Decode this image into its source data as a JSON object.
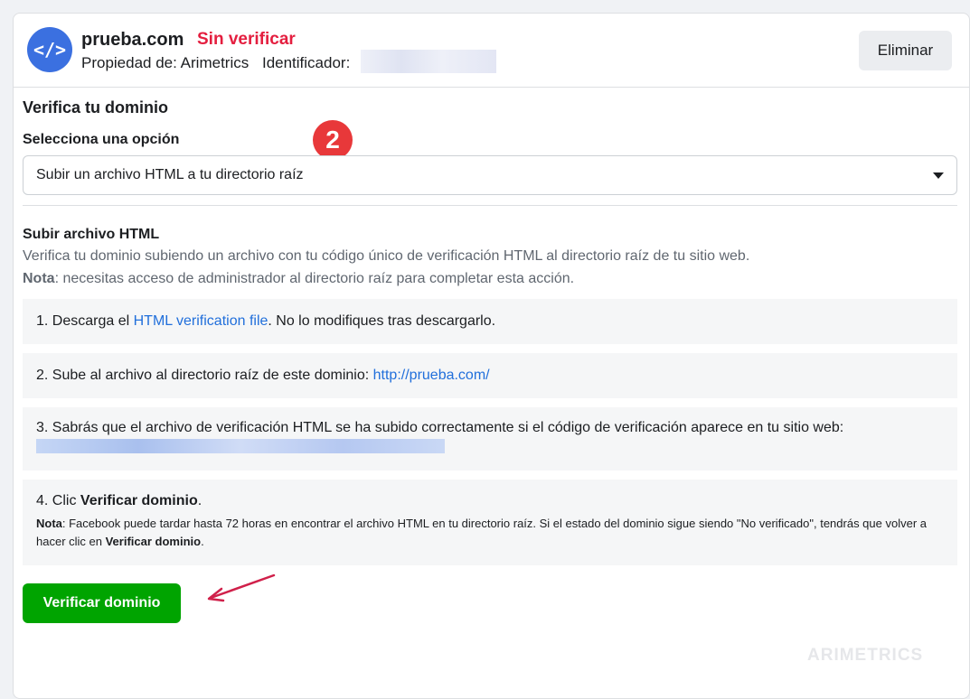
{
  "header": {
    "avatar_icon": "code-icon",
    "avatar_glyph": "</>",
    "domain": "prueba.com",
    "status": "Sin verificar",
    "owner_prefix": "Propiedad de:",
    "owner": "Arimetrics",
    "identifier_label": "Identificador:",
    "delete_label": "Eliminar"
  },
  "verify": {
    "title": "Verifica tu dominio",
    "select_label": "Selecciona una opción",
    "step_badge": "2",
    "selected_option": "Subir un archivo HTML a tu directorio raíz"
  },
  "upload": {
    "title": "Subir archivo HTML",
    "description": "Verifica tu dominio subiendo un archivo con tu código único de verificación HTML al directorio raíz de tu sitio web.",
    "note_label": "Nota",
    "note_text": ": necesitas acceso de administrador al directorio raíz para completar esta acción."
  },
  "steps": {
    "step1_prefix": "1. Descarga el ",
    "step1_link": "HTML verification file",
    "step1_suffix": ". No lo modifiques tras descargarlo.",
    "step2_prefix": "2. Sube al archivo al directorio raíz de este dominio: ",
    "step2_link": "http://prueba.com/",
    "step3_text": "3. Sabrás que el archivo de verificación HTML se ha subido correctamente si el código de verificación aparece en tu sitio web:",
    "step4_prefix": "4. Clic ",
    "step4_bold": "Verificar dominio",
    "step4_suffix": ".",
    "step4_note_label": "Nota",
    "step4_note_text": ": Facebook puede tardar hasta 72 horas en encontrar el archivo HTML en tu directorio raíz. Si el estado del dominio sigue siendo \"No verificado\", tendrás que volver a hacer clic en ",
    "step4_note_bold": "Verificar dominio",
    "step4_note_end": "."
  },
  "actions": {
    "verify_label": "Verificar dominio"
  },
  "watermark": "ARIMETRICS",
  "colors": {
    "status": "#e41e3f",
    "link": "#216fdb",
    "verify_button": "#00a400",
    "badge": "#e8383a",
    "avatar": "#3b70e0"
  }
}
